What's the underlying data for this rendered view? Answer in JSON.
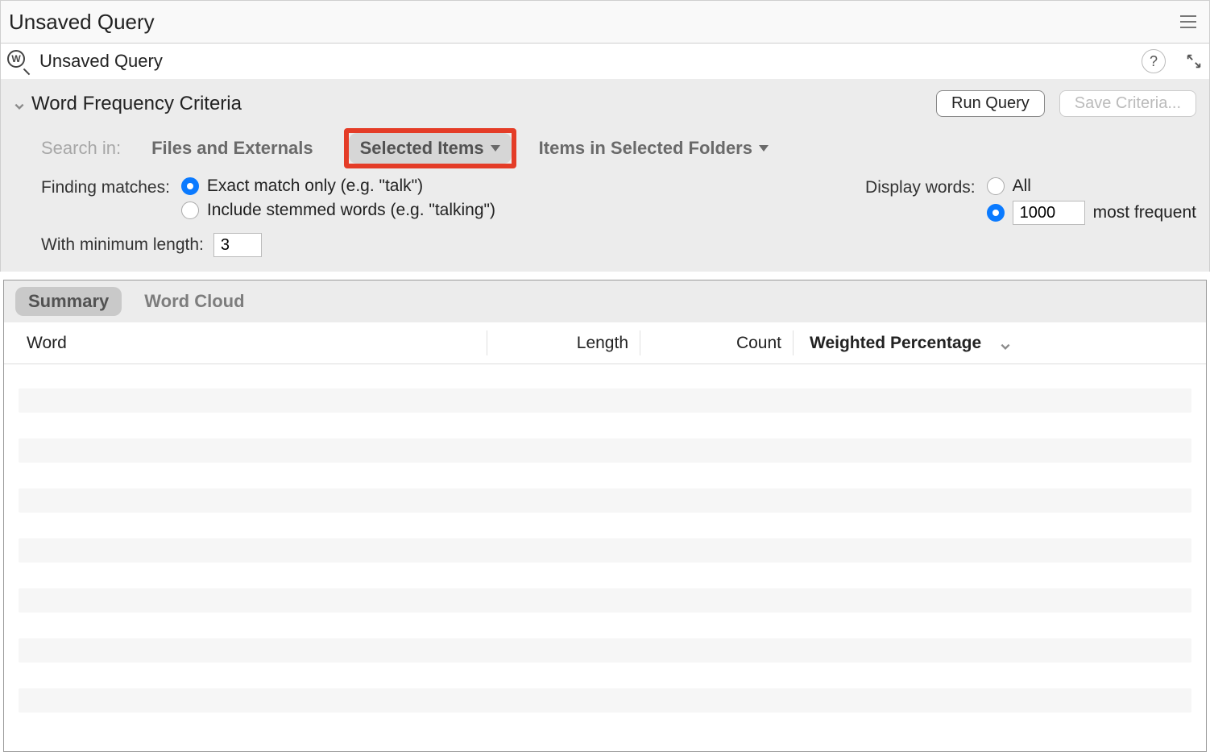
{
  "window": {
    "title": "Unsaved Query"
  },
  "breadcrumb": {
    "label": "Unsaved Query",
    "help": "?"
  },
  "criteria": {
    "title": "Word Frequency Criteria",
    "run_label": "Run Query",
    "save_label": "Save Criteria...",
    "search_in_label": "Search in:",
    "search_in_options": {
      "files_externals": "Files and Externals",
      "selected_items": "Selected Items",
      "items_in_folders": "Items in Selected Folders"
    },
    "finding_matches_label": "Finding matches:",
    "match_options": {
      "exact": "Exact match only (e.g. \"talk\")",
      "stemmed": "Include stemmed words (e.g. \"talking\")"
    },
    "match_selected": "exact",
    "display_words_label": "Display words:",
    "display_options": {
      "all": "All",
      "most_frequent_suffix": "most frequent"
    },
    "display_selected": "most_frequent",
    "display_count": "1000",
    "min_length_label": "With minimum length:",
    "min_length_value": "3"
  },
  "results": {
    "tabs": {
      "summary": "Summary",
      "word_cloud": "Word Cloud"
    },
    "active_tab": "summary",
    "columns": {
      "word": "Word",
      "length": "Length",
      "count": "Count",
      "weighted": "Weighted Percentage"
    },
    "rows": []
  }
}
